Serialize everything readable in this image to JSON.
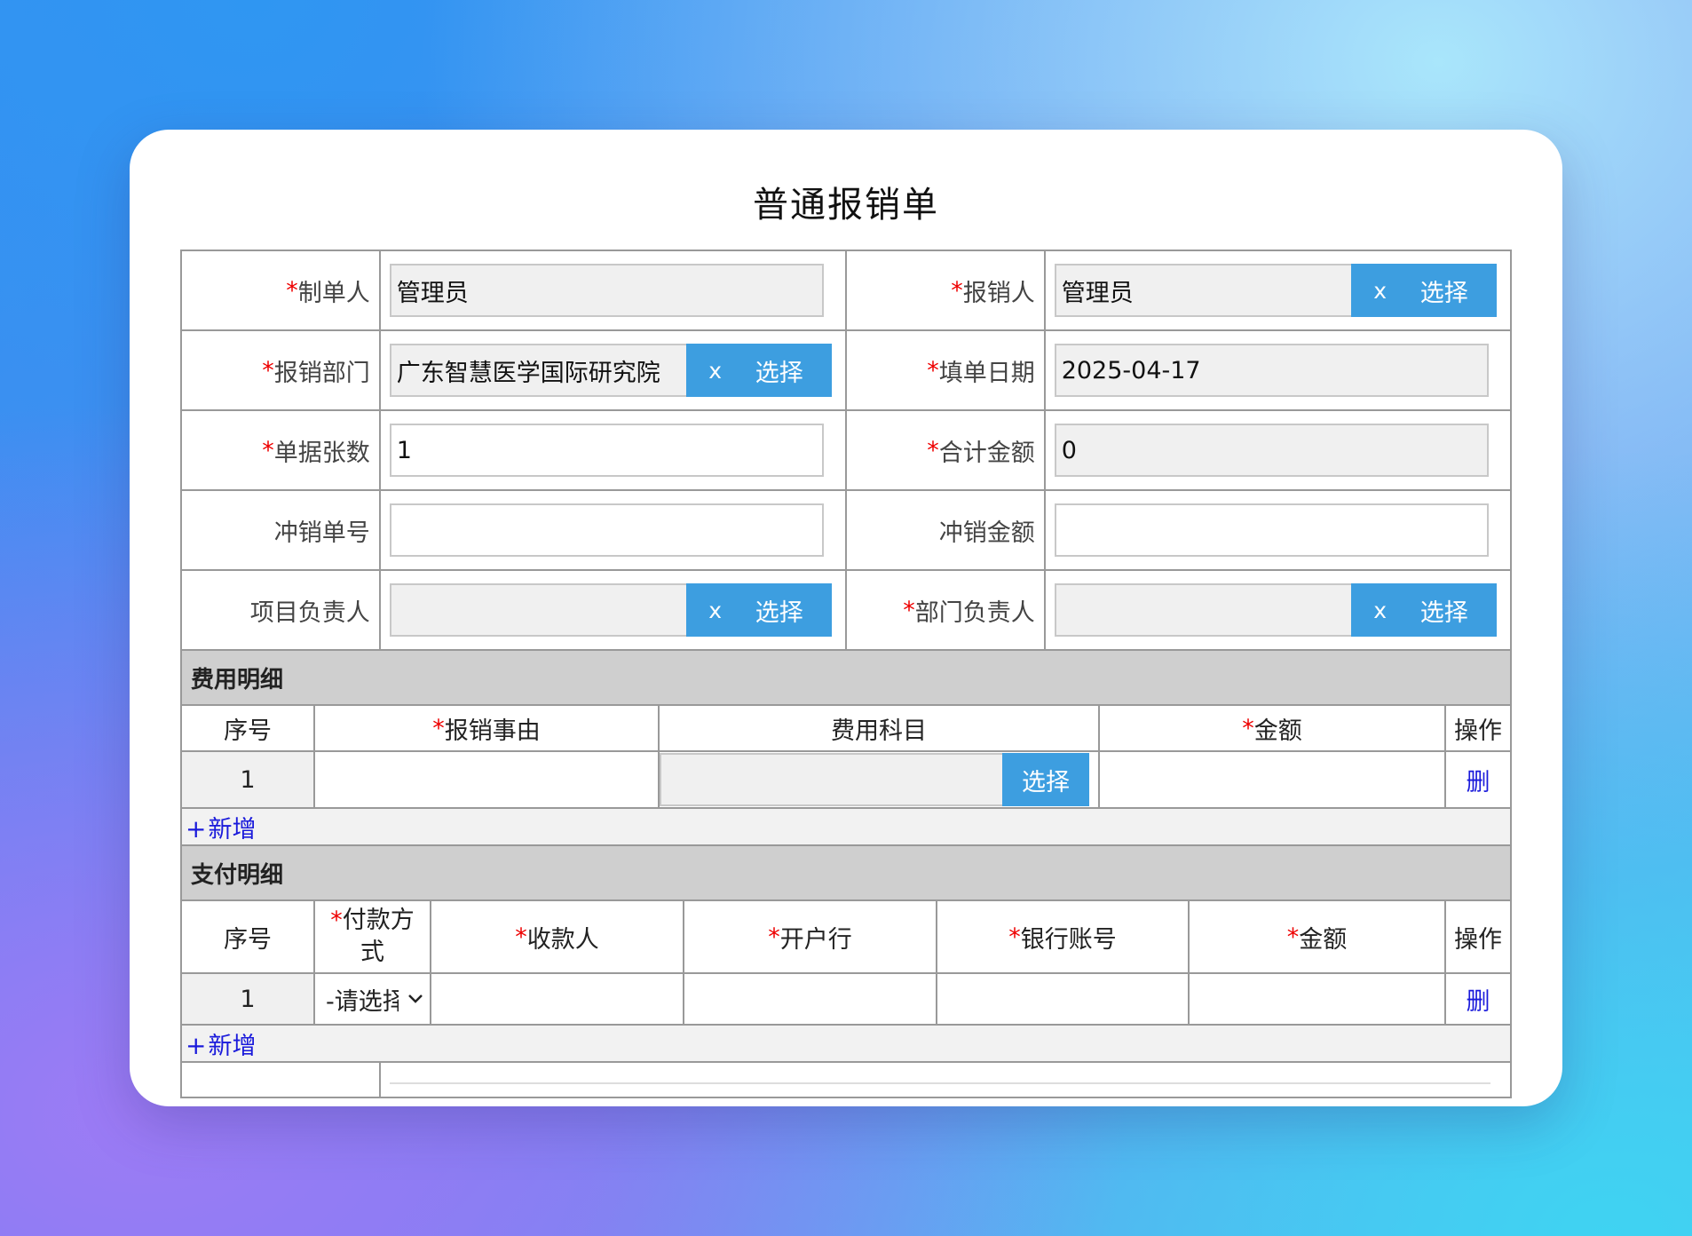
{
  "title": "普通报销单",
  "required_mark": "*",
  "fields": {
    "maker": {
      "label": "制单人",
      "value": "管理员"
    },
    "claimant": {
      "label": "报销人",
      "value": "管理员"
    },
    "department": {
      "label": "报销部门",
      "value": "广东智慧医学国际研究院"
    },
    "fill_date": {
      "label": "填单日期",
      "value": "2025-04-17"
    },
    "doc_count": {
      "label": "单据张数",
      "value": "1"
    },
    "total": {
      "label": "合计金额",
      "value": "0"
    },
    "offset_no": {
      "label": "冲销单号",
      "value": ""
    },
    "offset_amount": {
      "label": "冲销金额",
      "value": ""
    },
    "project_lead": {
      "label": "项目负责人",
      "value": ""
    },
    "dept_lead": {
      "label": "部门负责人",
      "value": ""
    }
  },
  "picker": {
    "clear": "x",
    "choose": "选择"
  },
  "expense": {
    "title": "费用明细",
    "headers": {
      "seq": "序号",
      "reason": "报销事由",
      "subject": "费用科目",
      "amount": "金额",
      "op": "操作"
    },
    "rows": [
      {
        "seq": "1",
        "reason": "",
        "subject": "",
        "choose": "选择",
        "amount": "",
        "delete": "删"
      }
    ],
    "add": "新增",
    "plus": "+"
  },
  "payment": {
    "title": "支付明细",
    "headers": {
      "seq": "序号",
      "method_1": "付款方",
      "method_2": "式",
      "payee": "收款人",
      "bank": "开户行",
      "account": "银行账号",
      "amount": "金额",
      "op": "操作"
    },
    "rows": [
      {
        "seq": "1",
        "method": "-请选择",
        "payee": "",
        "bank": "",
        "account": "",
        "amount": "",
        "delete": "删"
      }
    ],
    "add": "新增",
    "plus": "+"
  }
}
